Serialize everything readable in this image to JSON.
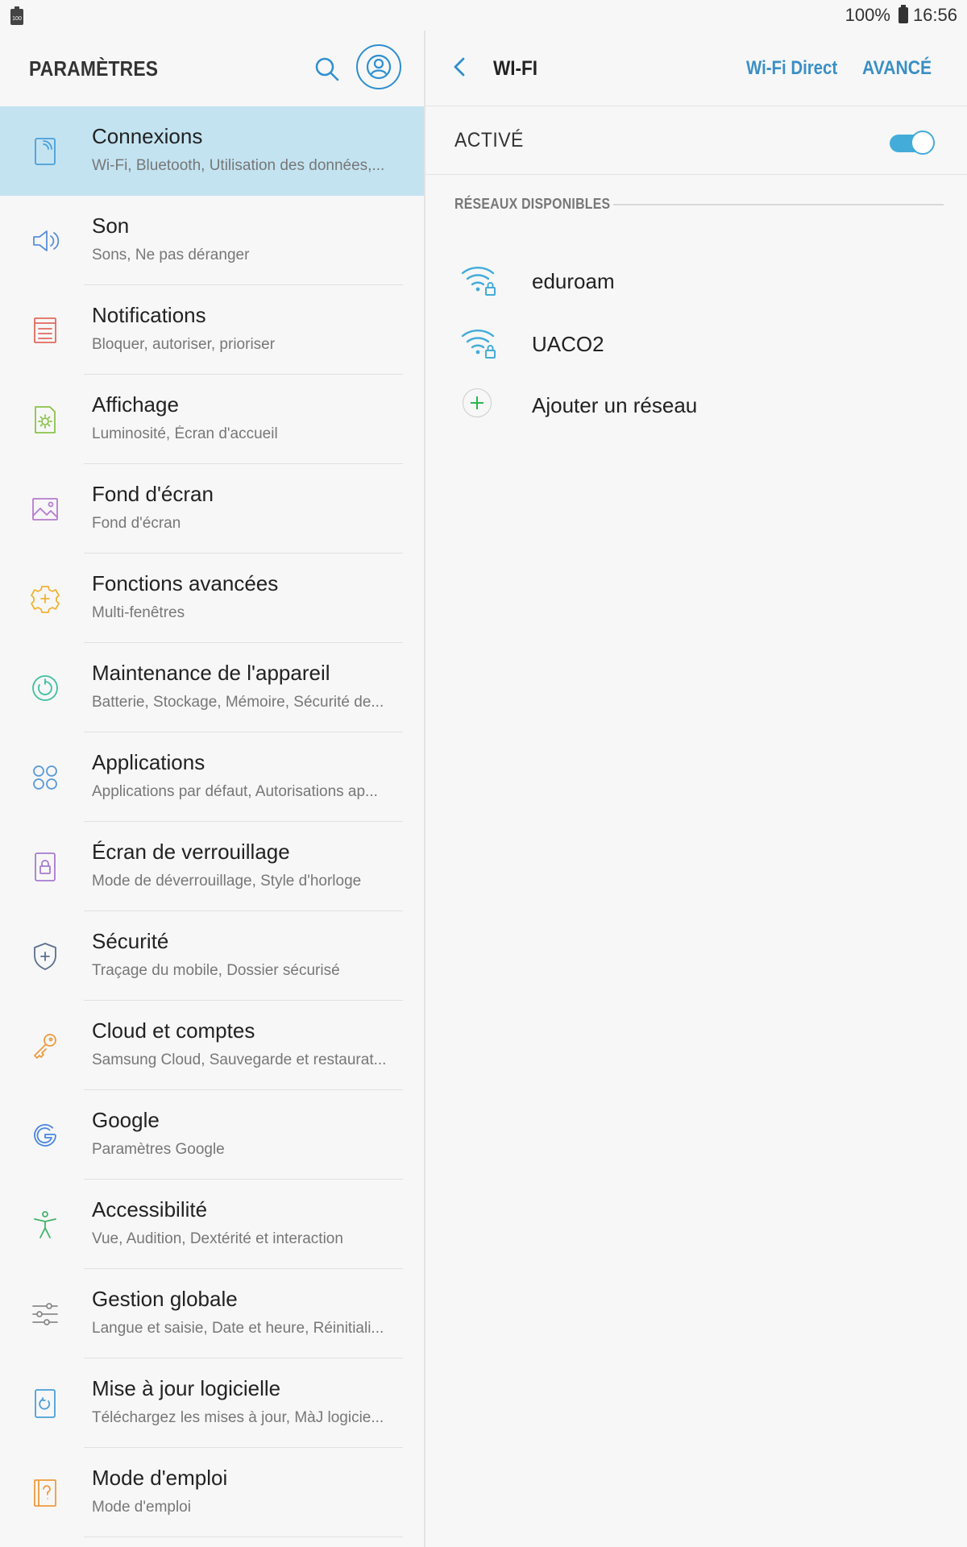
{
  "status_bar": {
    "battery_percent": "100%",
    "time": "16:56"
  },
  "left": {
    "title": "PARAMÈTRES",
    "items": [
      {
        "title": "Connexions",
        "subtitle": "Wi-Fi, Bluetooth, Utilisation des données,...",
        "icon": "connections-icon",
        "color": "#4a9fd8",
        "active": true
      },
      {
        "title": "Son",
        "subtitle": "Sons, Ne pas déranger",
        "icon": "sound-icon",
        "color": "#5b8fd8"
      },
      {
        "title": "Notifications",
        "subtitle": "Bloquer, autoriser, prioriser",
        "icon": "notifications-icon",
        "color": "#e26a5e"
      },
      {
        "title": "Affichage",
        "subtitle": "Luminosité, Écran d'accueil",
        "icon": "display-icon",
        "color": "#8bc34a"
      },
      {
        "title": "Fond d'écran",
        "subtitle": "Fond d'écran",
        "icon": "wallpaper-icon",
        "color": "#b67bd0"
      },
      {
        "title": "Fonctions avancées",
        "subtitle": "Multi-fenêtres",
        "icon": "advanced-features-icon",
        "color": "#f2b233"
      },
      {
        "title": "Maintenance de l'appareil",
        "subtitle": "Batterie, Stockage, Mémoire, Sécurité de...",
        "icon": "device-maintenance-icon",
        "color": "#3fbfa0"
      },
      {
        "title": "Applications",
        "subtitle": "Applications par défaut, Autorisations ap...",
        "icon": "apps-icon",
        "color": "#5b9ad8"
      },
      {
        "title": "Écran de verrouillage",
        "subtitle": "Mode de déverrouillage, Style d'horloge",
        "icon": "lock-screen-icon",
        "color": "#a67bd0"
      },
      {
        "title": "Sécurité",
        "subtitle": "Traçage du mobile, Dossier sécurisé",
        "icon": "shield-icon",
        "color": "#5a6f90"
      },
      {
        "title": "Cloud et comptes",
        "subtitle": "Samsung Cloud, Sauvegarde et restaurat...",
        "icon": "key-icon",
        "color": "#f09a3e"
      },
      {
        "title": "Google",
        "subtitle": "Paramètres Google",
        "icon": "google-icon",
        "color": "#4a86e0"
      },
      {
        "title": "Accessibilité",
        "subtitle": "Vue, Audition, Dextérité et interaction",
        "icon": "accessibility-icon",
        "color": "#45b36b"
      },
      {
        "title": "Gestion globale",
        "subtitle": "Langue et saisie, Date et heure, Réinitiali...",
        "icon": "sliders-icon",
        "color": "#8a8a8a"
      },
      {
        "title": "Mise à jour logicielle",
        "subtitle": "Téléchargez les mises à jour, MàJ logicie...",
        "icon": "software-update-icon",
        "color": "#4a9fd8"
      },
      {
        "title": "Mode d'emploi",
        "subtitle": "Mode d'emploi",
        "icon": "user-manual-icon",
        "color": "#f09a3e"
      }
    ]
  },
  "right": {
    "title": "WI-FI",
    "wifi_direct": "Wi-Fi Direct",
    "advanced": "AVANCÉ",
    "toggle_label": "ACTIVÉ",
    "toggle_on": true,
    "section_header": "RÉSEAUX DISPONIBLES",
    "networks": [
      {
        "name": "eduroam",
        "icon": "wifi-lock-icon"
      },
      {
        "name": "UACO2",
        "icon": "wifi-lock-icon"
      }
    ],
    "add_network": "Ajouter un réseau"
  },
  "colors": {
    "accent": "#3a8fc5",
    "active_row": "#c3e3f1",
    "toggle": "#44acd9",
    "wifi": "#44acd9",
    "add_plus": "#2bb54a"
  }
}
